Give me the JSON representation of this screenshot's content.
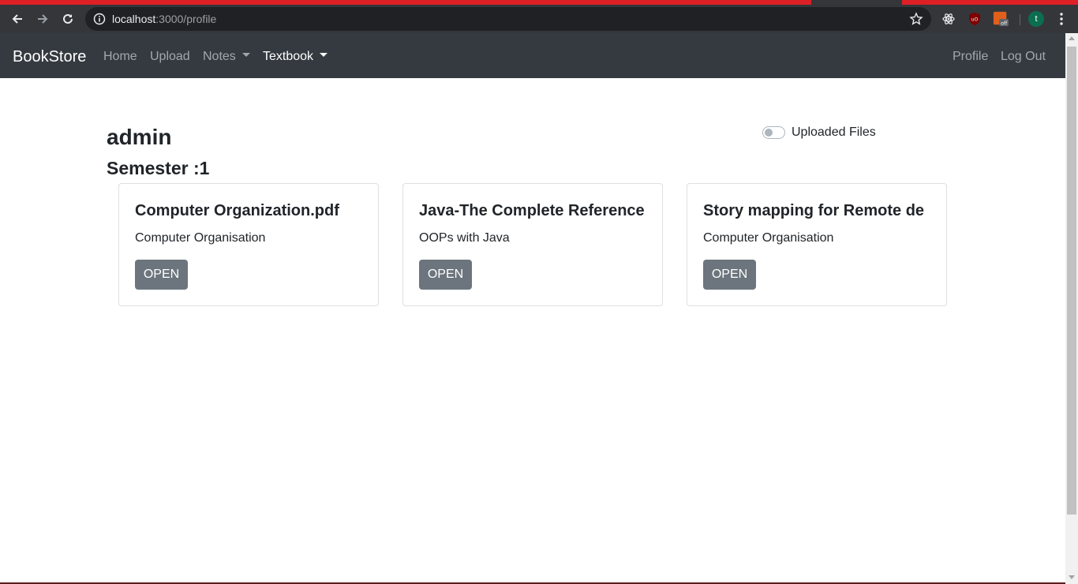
{
  "browser": {
    "url_host": "localhost",
    "url_path": ":3000/profile",
    "avatar_letter": "t",
    "extension_pdf_badge": "off"
  },
  "navbar": {
    "brand": "BookStore",
    "links": {
      "home": "Home",
      "upload": "Upload",
      "notes": "Notes",
      "textbook": "Textbook",
      "profile": "Profile",
      "logout": "Log Out"
    }
  },
  "profile": {
    "username": "admin",
    "semester": "Semester :1",
    "toggle_label": "Uploaded Files",
    "toggle_on": false
  },
  "cards": [
    {
      "title": "Computer Organization.pdf",
      "subject": "Computer Organisation",
      "button": "OPEN"
    },
    {
      "title": "Java-The Complete Reference",
      "subject": "OOPs with Java",
      "button": "OPEN"
    },
    {
      "title": "Story mapping for Remote de",
      "subject": "Computer Organisation",
      "button": "OPEN"
    }
  ],
  "colors": {
    "navbar_bg": "#343a40",
    "button_bg": "#6c757d",
    "accent_red": "#dd1f26"
  }
}
